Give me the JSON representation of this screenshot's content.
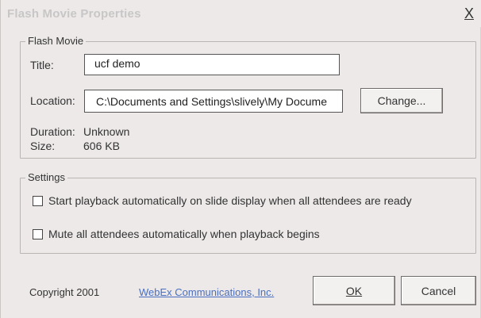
{
  "window": {
    "title": "Flash Movie Properties",
    "close_glyph": "X"
  },
  "flash_movie": {
    "legend": "Flash Movie",
    "title_label": "Title:",
    "title_value": "ucf demo",
    "location_label": "Location:",
    "location_value": "C:\\Documents and Settings\\slively\\My Docume",
    "change_button": "Change...",
    "duration_label": "Duration:",
    "duration_value": "Unknown",
    "size_label": "Size:",
    "size_value": "606 KB"
  },
  "settings": {
    "legend": "Settings",
    "autostart": {
      "label": "Start playback automatically on slide display when all attendees are ready",
      "checked": false
    },
    "mute": {
      "label": "Mute all attendees automatically when playback begins",
      "checked": false
    }
  },
  "footer": {
    "copyright": "Copyright 2001",
    "link_text": "WebEx Communications, Inc.",
    "ok_button": "OK",
    "cancel_button": "Cancel"
  },
  "colors": {
    "dialog_bg": "#ece9e8",
    "link": "#4a6fc2",
    "title_text": "#c8c6c6"
  }
}
